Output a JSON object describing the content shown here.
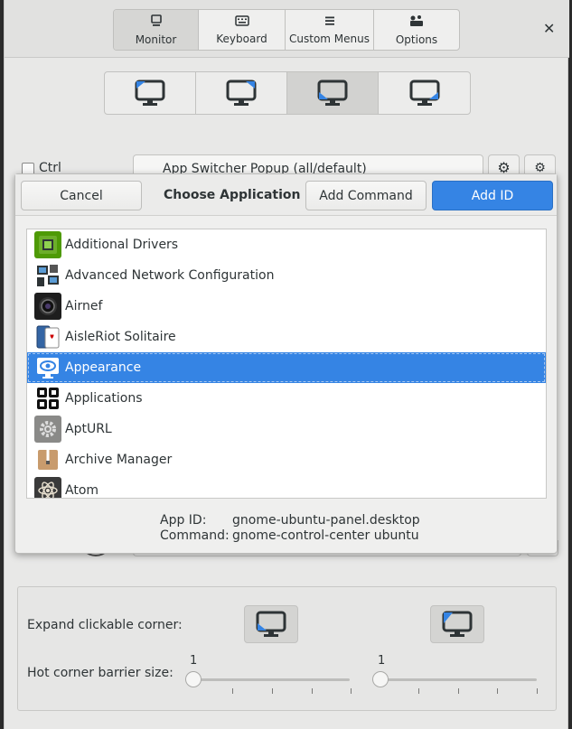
{
  "header": {
    "tabs": [
      {
        "label": "Monitor",
        "icon": "monitor-icon"
      },
      {
        "label": "Keyboard",
        "icon": "keyboard-icon"
      },
      {
        "label": "Custom Menus",
        "icon": "menu-icon"
      },
      {
        "label": "Options",
        "icon": "options-icon"
      }
    ],
    "active_tab": "Monitor",
    "close_symbol": "✕"
  },
  "monitor_corners": [
    "top-left",
    "top-right",
    "bottom-left",
    "bottom-right"
  ],
  "background_row": {
    "ctrl_label": "Ctrl",
    "action_value": "App Switcher Popup (all/default)"
  },
  "dialog": {
    "cancel_label": "Cancel",
    "title": "Choose Application",
    "add_command_label": "Add Command",
    "add_id_label": "Add ID",
    "apps": [
      {
        "name": "Additional Drivers",
        "icon": "chip-icon"
      },
      {
        "name": "Advanced Network Configuration",
        "icon": "network-icon"
      },
      {
        "name": "Airnef",
        "icon": "camera-icon"
      },
      {
        "name": "AisleRiot Solitaire",
        "icon": "cards-icon"
      },
      {
        "name": "Appearance",
        "icon": "appearance-icon"
      },
      {
        "name": "Applications",
        "icon": "grid-icon"
      },
      {
        "name": "AptURL",
        "icon": "gear-icon"
      },
      {
        "name": "Archive Manager",
        "icon": "archive-icon"
      },
      {
        "name": "Atom",
        "icon": "atom-icon"
      }
    ],
    "selected_app": "Appearance",
    "app_id_label": "App ID:",
    "app_id_value": "gnome-ubuntu-panel.desktop",
    "command_label": "Command:",
    "command_value": "gnome-control-center ubuntu"
  },
  "bottom": {
    "expand_label": "Expand clickable corner:",
    "barrier_label": "Hot corner barrier size:",
    "slider1_value": "1",
    "slider2_value": "1"
  },
  "colors": {
    "accent": "#3584e4",
    "window_bg": "#e8e8e7"
  }
}
